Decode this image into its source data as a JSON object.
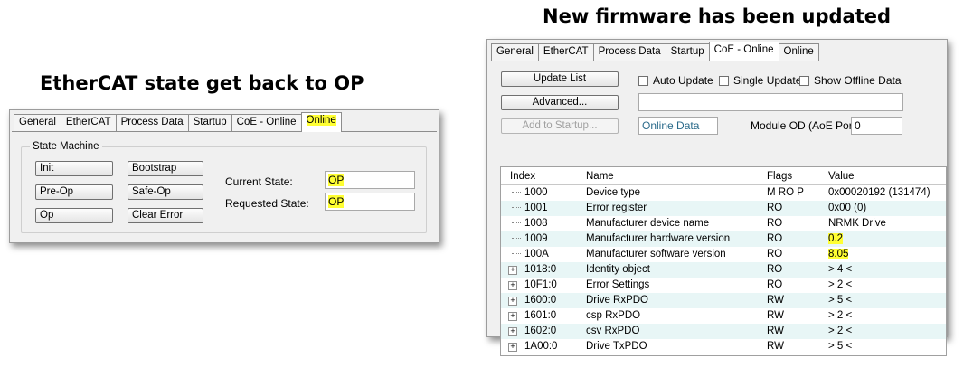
{
  "captions": {
    "left": "EtherCAT state get back to OP",
    "right": "New firmware has been updated"
  },
  "colors": {
    "highlight": "#ffff33",
    "row_alt": "#e8f6f6",
    "window_bg": "#f0f0f0"
  },
  "left_window": {
    "tabs": [
      {
        "label": "General"
      },
      {
        "label": "EtherCAT"
      },
      {
        "label": "Process Data"
      },
      {
        "label": "Startup"
      },
      {
        "label": "CoE - Online"
      },
      {
        "label": "Online",
        "active": true
      }
    ],
    "group_title": "State Machine",
    "buttons": {
      "init": "Init",
      "bootstrap": "Bootstrap",
      "preop": "Pre-Op",
      "safeop": "Safe-Op",
      "op": "Op",
      "clear_error": "Clear Error"
    },
    "current_state_label": "Current State:",
    "current_state_value": "OP",
    "requested_state_label": "Requested State:",
    "requested_state_value": "OP"
  },
  "right_window": {
    "tabs": [
      {
        "label": "General"
      },
      {
        "label": "EtherCAT"
      },
      {
        "label": "Process Data"
      },
      {
        "label": "Startup"
      },
      {
        "label": "CoE - Online",
        "active": true
      },
      {
        "label": "Online"
      }
    ],
    "buttons": {
      "update_list": "Update List",
      "advanced": "Advanced...",
      "add_to_startup": "Add to Startup..."
    },
    "checkboxes": {
      "auto_update": "Auto Update",
      "single_update": "Single Update",
      "show_offline": "Show Offline Data"
    },
    "online_data_label": "Online Data",
    "module_od_label": "Module OD (AoE Port):",
    "module_od_value": "0",
    "columns": [
      "Index",
      "Name",
      "Flags",
      "Value"
    ],
    "rows": [
      {
        "index": "1000",
        "name": "Device type",
        "flags": "M RO P",
        "value": "0x00020192 (131474)",
        "expandable": false
      },
      {
        "index": "1001",
        "name": "Error register",
        "flags": "RO",
        "value": "0x00 (0)",
        "expandable": false
      },
      {
        "index": "1008",
        "name": "Manufacturer device name",
        "flags": "RO",
        "value": "NRMK Drive",
        "expandable": false
      },
      {
        "index": "1009",
        "name": "Manufacturer hardware version",
        "flags": "RO",
        "value": "0.2",
        "expandable": false
      },
      {
        "index": "100A",
        "name": "Manufacturer software version",
        "flags": "RO",
        "value": "8.05",
        "expandable": false
      },
      {
        "index": "1018:0",
        "name": "Identity object",
        "flags": "RO",
        "value": "> 4 <",
        "expandable": true
      },
      {
        "index": "10F1:0",
        "name": "Error Settings",
        "flags": "RO",
        "value": "> 2 <",
        "expandable": true
      },
      {
        "index": "1600:0",
        "name": "Drive RxPDO",
        "flags": "RW",
        "value": "> 5 <",
        "expandable": true
      },
      {
        "index": "1601:0",
        "name": "csp RxPDO",
        "flags": "RW",
        "value": "> 2 <",
        "expandable": true
      },
      {
        "index": "1602:0",
        "name": "csv RxPDO",
        "flags": "RW",
        "value": "> 2 <",
        "expandable": true
      },
      {
        "index": "1A00:0",
        "name": "Drive TxPDO",
        "flags": "RW",
        "value": "> 5 <",
        "expandable": true
      }
    ]
  }
}
